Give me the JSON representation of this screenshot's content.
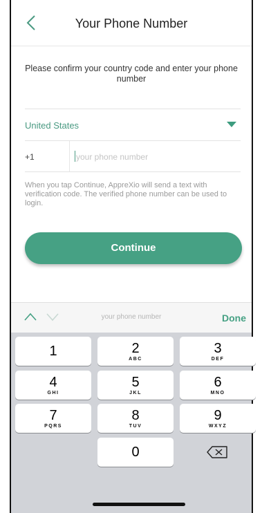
{
  "header": {
    "title": "Your Phone Number",
    "back_icon": "chevron-left-icon"
  },
  "instructions": "Please confirm your country code and enter your phone number",
  "country": {
    "label": "United States",
    "caret_icon": "triangle-down-icon"
  },
  "phone": {
    "dial_code": "+1",
    "placeholder": "your phone number",
    "value": ""
  },
  "helper_text": "When you tap Continue, AppreXio will send a text with verification code. The verified phone number can be used to login.",
  "continue_label": "Continue",
  "keyboard": {
    "toolbar_field": "your phone number",
    "done_label": "Done",
    "keys": [
      {
        "num": "1",
        "letters": ""
      },
      {
        "num": "2",
        "letters": "ABC"
      },
      {
        "num": "3",
        "letters": "DEF"
      },
      {
        "num": "4",
        "letters": "GHI"
      },
      {
        "num": "5",
        "letters": "JKL"
      },
      {
        "num": "6",
        "letters": "MNO"
      },
      {
        "num": "7",
        "letters": "PQRS"
      },
      {
        "num": "8",
        "letters": "TUV"
      },
      {
        "num": "9",
        "letters": "WXYZ"
      },
      {
        "num": "0",
        "letters": ""
      }
    ]
  },
  "colors": {
    "accent": "#46a184",
    "keyboard_bg": "#d1d3d8"
  }
}
